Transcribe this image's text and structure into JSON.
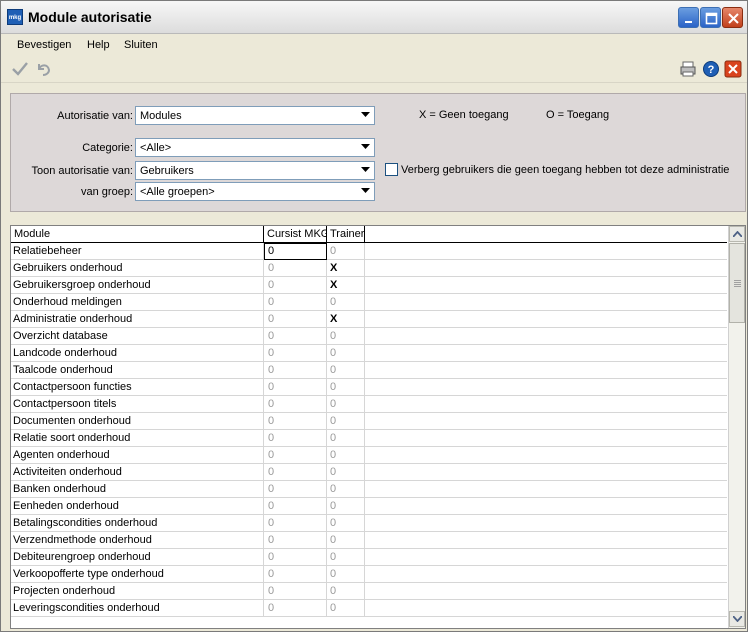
{
  "window": {
    "title": "Module autorisatie",
    "app_icon_text": "mkg"
  },
  "menu": [
    "Bevestigen",
    "Help",
    "Sluiten"
  ],
  "toolbar": {
    "icons": [
      "confirm-check-icon",
      "undo-icon",
      "print-icon",
      "help-icon",
      "close-icon"
    ]
  },
  "filters": {
    "autorisatie_van": {
      "label": "Autorisatie van:",
      "value": "Modules"
    },
    "categorie": {
      "label": "Categorie:",
      "value": "<Alle>"
    },
    "toon_autorisatie_van": {
      "label": "Toon autorisatie van:",
      "value": "Gebruikers"
    },
    "van_groep": {
      "label": "van groep:",
      "value": "<Alle groepen>"
    },
    "legend_x": "X = Geen toegang",
    "legend_o": "O = Toegang",
    "hide_users_checkbox": {
      "label": "Verberg gebruikers die geen toegang hebben tot deze administratie",
      "checked": false
    }
  },
  "grid": {
    "columns": [
      "Module",
      "Cursist MKG",
      "Trainer"
    ],
    "rows": [
      {
        "module": "Relatiebeheer",
        "cursist": "0",
        "trainer": "0"
      },
      {
        "module": "Gebruikers onderhoud",
        "cursist": "0",
        "trainer": "X"
      },
      {
        "module": "Gebruikersgroep onderhoud",
        "cursist": "0",
        "trainer": "X"
      },
      {
        "module": "Onderhoud meldingen",
        "cursist": "0",
        "trainer": "0"
      },
      {
        "module": "Administratie onderhoud",
        "cursist": "0",
        "trainer": "X"
      },
      {
        "module": "Overzicht database",
        "cursist": "0",
        "trainer": "0"
      },
      {
        "module": "Landcode onderhoud",
        "cursist": "0",
        "trainer": "0"
      },
      {
        "module": "Taalcode onderhoud",
        "cursist": "0",
        "trainer": "0"
      },
      {
        "module": "Contactpersoon functies",
        "cursist": "0",
        "trainer": "0"
      },
      {
        "module": "Contactpersoon titels",
        "cursist": "0",
        "trainer": "0"
      },
      {
        "module": "Documenten onderhoud",
        "cursist": "0",
        "trainer": "0"
      },
      {
        "module": "Relatie soort onderhoud",
        "cursist": "0",
        "trainer": "0"
      },
      {
        "module": "Agenten onderhoud",
        "cursist": "0",
        "trainer": "0"
      },
      {
        "module": "Activiteiten onderhoud",
        "cursist": "0",
        "trainer": "0"
      },
      {
        "module": "Banken onderhoud",
        "cursist": "0",
        "trainer": "0"
      },
      {
        "module": "Eenheden onderhoud",
        "cursist": "0",
        "trainer": "0"
      },
      {
        "module": "Betalingscondities onderhoud",
        "cursist": "0",
        "trainer": "0"
      },
      {
        "module": "Verzendmethode onderhoud",
        "cursist": "0",
        "trainer": "0"
      },
      {
        "module": "Debiteurengroep onderhoud",
        "cursist": "0",
        "trainer": "0"
      },
      {
        "module": "Verkoopofferte type onderhoud",
        "cursist": "0",
        "trainer": "0"
      },
      {
        "module": "Projecten onderhoud",
        "cursist": "0",
        "trainer": "0"
      },
      {
        "module": "Leveringscondities onderhoud",
        "cursist": "0",
        "trainer": "0"
      }
    ]
  }
}
